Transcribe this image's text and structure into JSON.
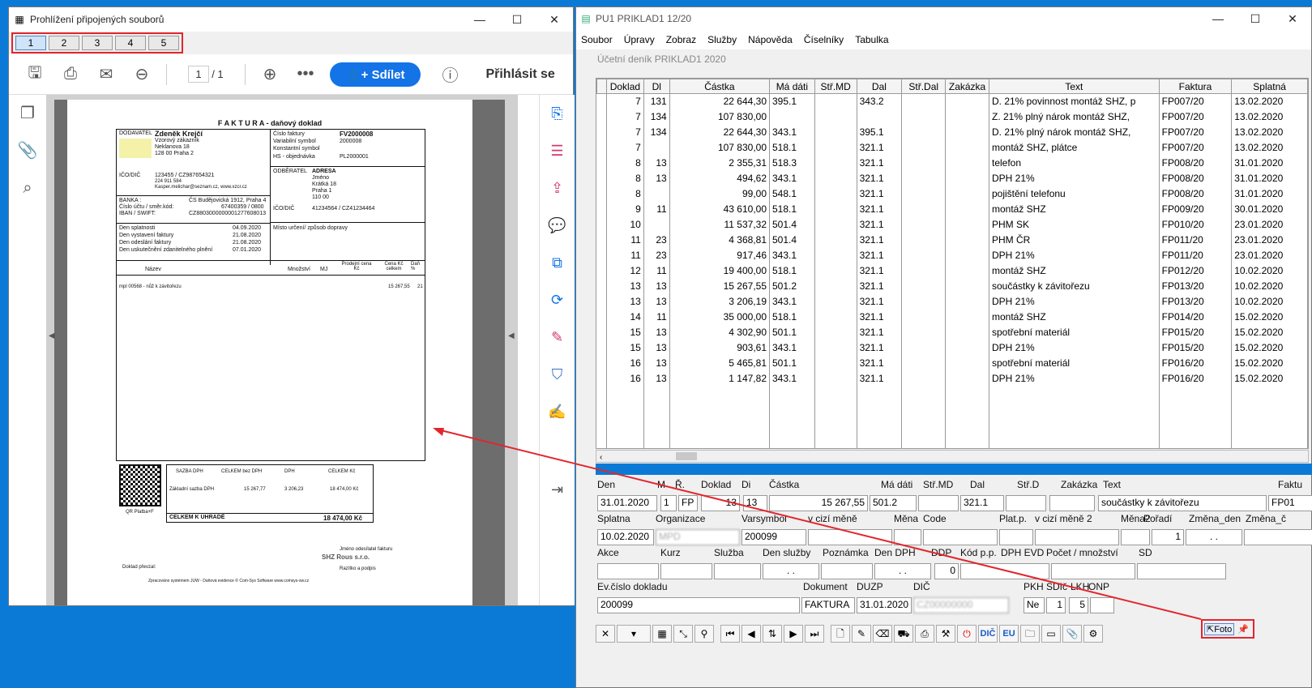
{
  "left": {
    "title": "Prohlížení připojených souborů",
    "tabs": [
      "1",
      "2",
      "3",
      "4",
      "5"
    ],
    "page_cur": "1",
    "page_total": "/ 1",
    "share": "Sdílet",
    "login": "Přihlásit se",
    "invoice": {
      "heading": "F A K T U R A - daňový doklad",
      "supplier_lbl": "DODAVATEL",
      "supplier": "Zdeněk Krejčí",
      "sup_line1": "Vzorový zákazník",
      "sup_line2": "Neklanova 18",
      "sup_line3": "128 00 Praha 2",
      "ico": "IČO/DIČ",
      "ico_val": "123455 / CZ987654321",
      "tel": "224 911 584",
      "email": "Kasper.melichar@seznam.cz, www.xzcr.cz",
      "bank_lbl": "BANKA :",
      "bank": "ČS Budějovická 1912, Praha 4",
      "acct_lbl": "Číslo účtu / směr.kód:",
      "acct": "67400359 / 0800",
      "iban_lbl": "IBAN / SWIFT:",
      "iban": "CZ8803000000001277608013",
      "inv_no_lbl": "Číslo faktury",
      "inv_no": "FV2000008",
      "var_lbl": "Variabilní symbol",
      "var": "2000008",
      "const_lbl": "Konstantní symbol",
      "hs_lbl": "HS - objednávka",
      "hs": "PL2000001",
      "cust_lbl": "ODBĚRATEL",
      "cust": "ADRESA",
      "cust1": "Jméno",
      "cust2": "Krátká 18",
      "cust3": "Praha 1",
      "cust4": "110 00",
      "cust_ico": "41234564 / CZ41234464",
      "place": "Místo určení/ způsob dopravy",
      "due_lbl": "Den splatnosti",
      "due": "04.09.2020",
      "iss_lbl": "Den vystavení faktury",
      "iss": "21.08.2020",
      "sent_lbl": "Den odeslání faktury",
      "sent": "21.08.2020",
      "tax_lbl": "Den uskutečnění zdanitelného plnění",
      "tax": "07.01.2020",
      "col_name": "Název",
      "col_qty": "Množství",
      "col_mj": "MJ",
      "col_price": "Prodejní cena Kč",
      "col_total": "Cena Kč celkem",
      "col_vat": "Daň %",
      "item": "mpl 00568 - nůž k závitořezu",
      "item_total": "15 267,55",
      "item_vat": "21",
      "vat_rate": "SAZBA DPH",
      "vat_base": "CELKEM bez DPH",
      "vat": "DPH",
      "vat_total": "CELKEM Kč",
      "vat_row": "Základní sazba DPH",
      "vat_row_base": "15 267,77",
      "vat_row_vat": "3 206,23",
      "vat_row_total": "18 474,00 Kč",
      "qr": "QR Platba+F",
      "grand_lbl": "CELKEM K ÚHRADĚ",
      "grand": "18 474,00 Kč",
      "issuer": "Jméno odesílatel fakturu",
      "company": "SHZ Rous s.r.o.",
      "stamp": "Razítko a podpis",
      "recv": "Doklad převzal:",
      "footer": "Zpracováno systémem JUW - Daňová evidence    © Com-Sys Software    www.comsys-sw.cz"
    }
  },
  "right": {
    "title": "PU1 PRIKLAD1 12/20",
    "menu": [
      "Soubor",
      "Úpravy",
      "Zobraz",
      "Služby",
      "Nápověda",
      "Číselníky",
      "Tabulka"
    ],
    "sub": "Účetní deník  PRIKLAD1    2020",
    "columns": [
      "Doklad",
      "Dl",
      "Částka",
      "Má dáti",
      "Stř.MD",
      "Dal",
      "Stř.Dal",
      "Zakázka",
      "Text",
      "Faktura",
      "Splatná"
    ],
    "rows": [
      [
        "7",
        "131",
        "22 644,30",
        "395.1",
        "",
        "343.2",
        "",
        "",
        "D. 21% povinnost montáž SHZ, p",
        "FP007/20",
        "13.02.2020"
      ],
      [
        "7",
        "134",
        "107 830,00",
        "",
        "",
        "",
        "",
        "",
        "Z. 21% plný nárok montáž SHZ,",
        "FP007/20",
        "13.02.2020"
      ],
      [
        "7",
        "134",
        "22 644,30",
        "343.1",
        "",
        "395.1",
        "",
        "",
        "D. 21% plný nárok montáž SHZ,",
        "FP007/20",
        "13.02.2020"
      ],
      [
        "7",
        "",
        "107 830,00",
        "518.1",
        "",
        "321.1",
        "",
        "",
        "montáž SHZ, plátce",
        "FP007/20",
        "13.02.2020"
      ],
      [
        "8",
        "13",
        "2 355,31",
        "518.3",
        "",
        "321.1",
        "",
        "",
        "telefon",
        "FP008/20",
        "31.01.2020"
      ],
      [
        "8",
        "13",
        "494,62",
        "343.1",
        "",
        "321.1",
        "",
        "",
        "DPH 21%",
        "FP008/20",
        "31.01.2020"
      ],
      [
        "8",
        "",
        "99,00",
        "548.1",
        "",
        "321.1",
        "",
        "",
        "pojištění telefonu",
        "FP008/20",
        "31.01.2020"
      ],
      [
        "9",
        "11",
        "43 610,00",
        "518.1",
        "",
        "321.1",
        "",
        "",
        "montáž SHZ",
        "FP009/20",
        "30.01.2020"
      ],
      [
        "10",
        "",
        "11 537,32",
        "501.4",
        "",
        "321.1",
        "",
        "",
        "PHM SK",
        "FP010/20",
        "23.01.2020"
      ],
      [
        "11",
        "23",
        "4 368,81",
        "501.4",
        "",
        "321.1",
        "",
        "",
        "PHM ČR",
        "FP011/20",
        "23.01.2020"
      ],
      [
        "11",
        "23",
        "917,46",
        "343.1",
        "",
        "321.1",
        "",
        "",
        "DPH 21%",
        "FP011/20",
        "23.01.2020"
      ],
      [
        "12",
        "11",
        "19 400,00",
        "518.1",
        "",
        "321.1",
        "",
        "",
        "montáž SHZ",
        "FP012/20",
        "10.02.2020"
      ],
      [
        "13",
        "13",
        "15 267,55",
        "501.2",
        "",
        "321.1",
        "",
        "",
        "součástky k závitořezu",
        "FP013/20",
        "10.02.2020"
      ],
      [
        "13",
        "13",
        "3 206,19",
        "343.1",
        "",
        "321.1",
        "",
        "",
        "DPH 21%",
        "FP013/20",
        "10.02.2020"
      ],
      [
        "14",
        "11",
        "35 000,00",
        "518.1",
        "",
        "321.1",
        "",
        "",
        "montáž SHZ",
        "FP014/20",
        "15.02.2020"
      ],
      [
        "15",
        "13",
        "4 302,90",
        "501.1",
        "",
        "321.1",
        "",
        "",
        "spotřební materiál",
        "FP015/20",
        "15.02.2020"
      ],
      [
        "15",
        "13",
        "903,61",
        "343.1",
        "",
        "321.1",
        "",
        "",
        "DPH 21%",
        "FP015/20",
        "15.02.2020"
      ],
      [
        "16",
        "13",
        "5 465,81",
        "501.1",
        "",
        "321.1",
        "",
        "",
        "spotřební materiál",
        "FP016/20",
        "15.02.2020"
      ],
      [
        "16",
        "13",
        "1 147,82",
        "343.1",
        "",
        "321.1",
        "",
        "",
        "DPH 21%",
        "FP016/20",
        "15.02.2020"
      ]
    ],
    "form": {
      "l_den": "Den",
      "l_m": "M",
      "l_r": "Ř.",
      "l_doklad": "Doklad",
      "l_di": "Di",
      "l_castka": "Částka",
      "l_madati": "Má dáti",
      "l_strmd": "Stř.MD",
      "l_dal": "Dal",
      "l_strd": "Stř.D",
      "l_zakazka": "Zakázka",
      "l_text": "Text",
      "l_faktura": "Faktu",
      "den": "31.01.2020",
      "m": "1",
      "r": "FP",
      "doklad": "13",
      "di": "13",
      "castka": "15 267,55",
      "madati": "501.2",
      "dal": "321.1",
      "text": "součástky k závitořezu",
      "faktura": "FP01",
      "l_splatna": "Splatna",
      "l_org": "Organizace",
      "l_vars": "Varsymbol",
      "l_cizi": "v cizí měně",
      "l_mena": "Měna",
      "l_code": "Code",
      "l_platp": "Plat.p.",
      "l_cizi2": "v cizí měně 2",
      "l_mena2": "Měna2",
      "l_poradi": "Pořadí",
      "l_zmena": "Změna_den",
      "l_zmenac": "Změna_č",
      "splatna": "10.02.2020",
      "org": "MPD",
      "vars": "200099",
      "poradi": "1",
      "zmena": ". .",
      "l_akce": "Akce",
      "l_kurz": "Kurz",
      "l_sluzba": "Služba",
      "l_densl": "Den služby",
      "l_pozn": "Poznámka",
      "l_dendph": "Den DPH",
      "l_ddp": "DDP",
      "l_kodpp": "Kód p.p.",
      "l_dphevd": "DPH EVD",
      "l_pocet": "Počet / množství",
      "l_sd": "SD",
      "densl": ". .",
      "dendph": ". .",
      "ddp": "0",
      "l_evc": "Ev.číslo dokladu",
      "l_dok": "Dokument",
      "l_duzp": "DUZP",
      "l_dic": "DIČ",
      "l_pkh": "PKH",
      "l_sdic": "SDIč",
      "l_lkh": "LKH",
      "l_onp": "ONP",
      "evc": "200099",
      "dok": "FAKTURA",
      "duzp": "31.01.2020",
      "dic": "CZ00000000",
      "pkh": "Ne",
      "sdic": "1",
      "lkh": "5"
    },
    "foto": "Foto",
    "dic_btn": "DIČ",
    "eu_btn": "EU"
  }
}
